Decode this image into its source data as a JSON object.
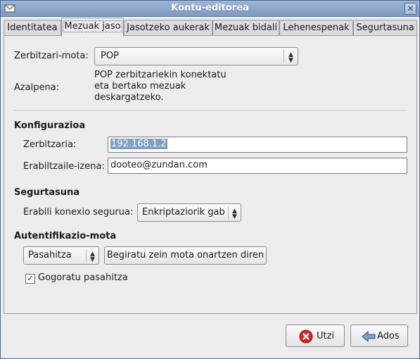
{
  "window": {
    "title": "Kontu-editorea",
    "close_label": "✕"
  },
  "tabs": [
    {
      "label": "Identitatea",
      "active": false
    },
    {
      "label": "Mezuak jaso",
      "active": true
    },
    {
      "label": "Jasotzeko aukerak",
      "active": false
    },
    {
      "label": "Mezuak bidali",
      "active": false
    },
    {
      "label": "Lehenespenak",
      "active": false
    },
    {
      "label": "Segurtasuna",
      "active": false
    }
  ],
  "server_type": {
    "label": "Zerbitzari-mota:",
    "value": "POP"
  },
  "description": {
    "label": "Azalpena:",
    "lines": [
      "POP zerbitzariekin konektatu",
      "eta bertako mezuak",
      "deskargatzeko."
    ]
  },
  "configuration": {
    "heading": "Konfigurazioa",
    "server_label": "Zerbitzaria:",
    "server_value": "192.168.1.2",
    "username_label": "Erabiltzaile-izena:",
    "username_value": "dooteo@zundan.com"
  },
  "security": {
    "heading": "Segurtasuna",
    "secure_label": "Erabili konexio segurua:",
    "secure_value": "Enkriptaziorik gabe"
  },
  "auth": {
    "heading": "Autentifikazio-mota",
    "type_value": "Pasahitza",
    "check_button": "Begiratu zein mota onartzen diren",
    "remember_label": "Gogoratu pasahitza",
    "remember_checked": true
  },
  "footer": {
    "cancel_label": "Utzi",
    "ok_label": "Ados"
  },
  "colors": {
    "titlebar": "#8fa8c8",
    "cancel_icon": "#d42424",
    "selection": "#7f9ec4"
  }
}
